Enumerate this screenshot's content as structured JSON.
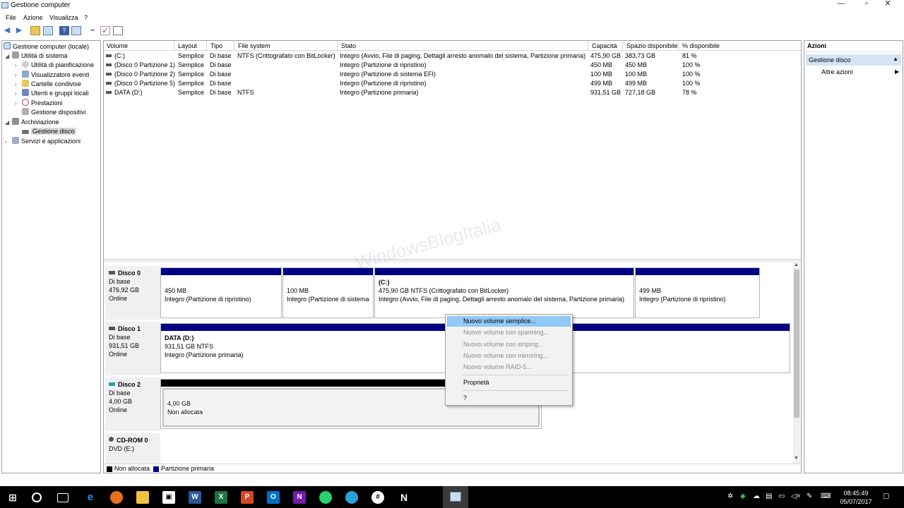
{
  "window": {
    "title": "Gestione computer"
  },
  "menu": [
    "File",
    "Azione",
    "Visualizza",
    "?"
  ],
  "tree": {
    "root": "Gestione computer (locale)",
    "items": [
      "Utilità di sistema",
      "Utilità di pianificazione",
      "Visualizzatore eventi",
      "Cartelle condivise",
      "Utenti e gruppi locali",
      "Prestazioni",
      "Gestione dispositivi",
      "Archiviazione",
      "Gestione disco",
      "Servizi e applicazioni"
    ]
  },
  "table": {
    "headers": [
      "Volume",
      "Layout",
      "Tipo",
      "File system",
      "Stato",
      "Capacità",
      "Spazio disponibile",
      "% disponibile"
    ],
    "rows": [
      [
        "(C:)",
        "Semplice",
        "Di base",
        "NTFS (Crittografato con BitLocker)",
        "Integro (Avvio, File di paging, Dettagli arresto anomalo del sistema, Partizione primaria)",
        "475,90 GB",
        "383,73 GB",
        "81 %"
      ],
      [
        "(Disco 0 Partizione 1)",
        "Semplice",
        "Di base",
        "",
        "Integro (Partizione di ripristino)",
        "450 MB",
        "450 MB",
        "100 %"
      ],
      [
        "(Disco 0 Partizione 2)",
        "Semplice",
        "Di base",
        "",
        "Integro (Partizione di sistema EFI)",
        "100 MB",
        "100 MB",
        "100 %"
      ],
      [
        "(Disco 0 Partizione 5)",
        "Semplice",
        "Di base",
        "",
        "Integro (Partizione di ripristino)",
        "499 MB",
        "499 MB",
        "100 %"
      ],
      [
        "DATA (D:)",
        "Semplice",
        "Di base",
        "NTFS",
        "Integro (Partizione primaria)",
        "931,51 GB",
        "727,18 GB",
        "78 %"
      ]
    ]
  },
  "disks": {
    "d0": {
      "name": "Disco 0",
      "type": "Di base",
      "size": "476,92 GB",
      "status": "Online",
      "p1": {
        "size": "450 MB",
        "status": "Integro (Partizione di ripristino)"
      },
      "p2": {
        "size": "100 MB",
        "status": "Integro (Partizione di sistema"
      },
      "p3": {
        "name": "(C:)",
        "size": "475,90 GB NTFS (Crittografato con BitLocker)",
        "status": "Integro (Avvio, File di paging, Dettagli arresto anomalo del sistema, Partizione primaria)"
      },
      "p4": {
        "size": "499 MB",
        "status": "Integro (Partizione di ripristino)"
      }
    },
    "d1": {
      "name": "Disco 1",
      "type": "Di base",
      "size": "931,51 GB",
      "status": "Online",
      "p1": {
        "name": "DATA  (D:)",
        "size": "931,51 GB NTFS",
        "status": "Integro (Partizione primaria)"
      }
    },
    "d2": {
      "name": "Disco 2",
      "type": "Di base",
      "size": "4,00 GB",
      "status": "Online",
      "p1": {
        "size": "4,00 GB",
        "status": "Non allocata"
      }
    },
    "d3": {
      "name": "CD-ROM 0",
      "type": "DVD (E:)"
    }
  },
  "legend": {
    "unallocated": "Non allocata",
    "primary": "Partizione primaria"
  },
  "actions": {
    "header": "Azioni",
    "section": "Gestione disco",
    "more": "Altre azioni"
  },
  "context_menu": {
    "new_simple": "Nuovo volume semplice...",
    "new_spanned": "Nuovo volume con spanning...",
    "new_striped": "Nuovo volume con striping...",
    "new_mirrored": "Nuovo volume con mirroring...",
    "new_raid5": "Nuovo volume RAID-5...",
    "properties": "Proprietà",
    "help": "?"
  },
  "watermark": "WindowsBlogItalia",
  "taskbar": {
    "time": "08:45:49",
    "date": "05/07/2017"
  },
  "colors": {
    "primary_partition": "#000080",
    "unallocated": "#000000",
    "highlight": "#91c9f7",
    "actions_section": "#d4e4f4"
  }
}
